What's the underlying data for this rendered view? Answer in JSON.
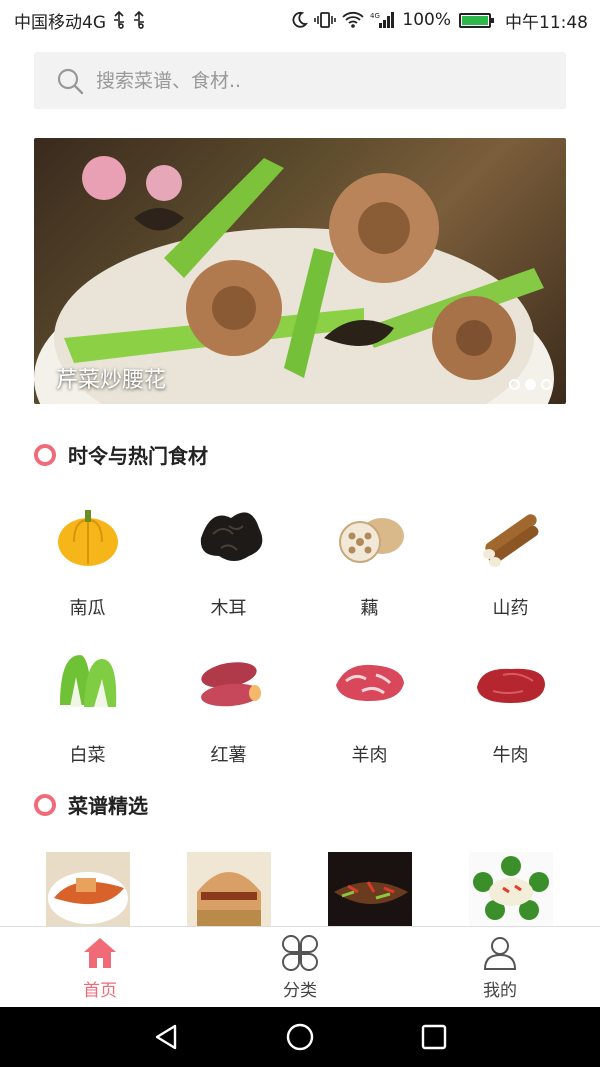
{
  "status_bar": {
    "carrier": "中国移动4G",
    "battery_text": "100%",
    "time": "中午11:48",
    "battery_level": 1.0
  },
  "search": {
    "placeholder": "搜索菜谱、食材.."
  },
  "banner": {
    "caption": "芹菜炒腰花",
    "slide_count": 3,
    "active_slide": 2
  },
  "sections": {
    "seasonal_title": "时令与热门食材",
    "recipes_title": "菜谱精选"
  },
  "ingredients": [
    {
      "label": "南瓜",
      "icon": "pumpkin-icon"
    },
    {
      "label": "木耳",
      "icon": "wood-ear-icon"
    },
    {
      "label": "藕",
      "icon": "lotus-root-icon"
    },
    {
      "label": "山药",
      "icon": "yam-icon"
    },
    {
      "label": "白菜",
      "icon": "cabbage-icon"
    },
    {
      "label": "红薯",
      "icon": "sweet-potato-icon"
    },
    {
      "label": "羊肉",
      "icon": "lamb-icon"
    },
    {
      "label": "牛肉",
      "icon": "beef-icon"
    }
  ],
  "tabs": [
    {
      "label": "首页",
      "icon": "home-icon",
      "active": true
    },
    {
      "label": "分类",
      "icon": "category-icon",
      "active": false
    },
    {
      "label": "我的",
      "icon": "profile-icon",
      "active": false
    }
  ],
  "colors": {
    "accent": "#f06a78"
  }
}
